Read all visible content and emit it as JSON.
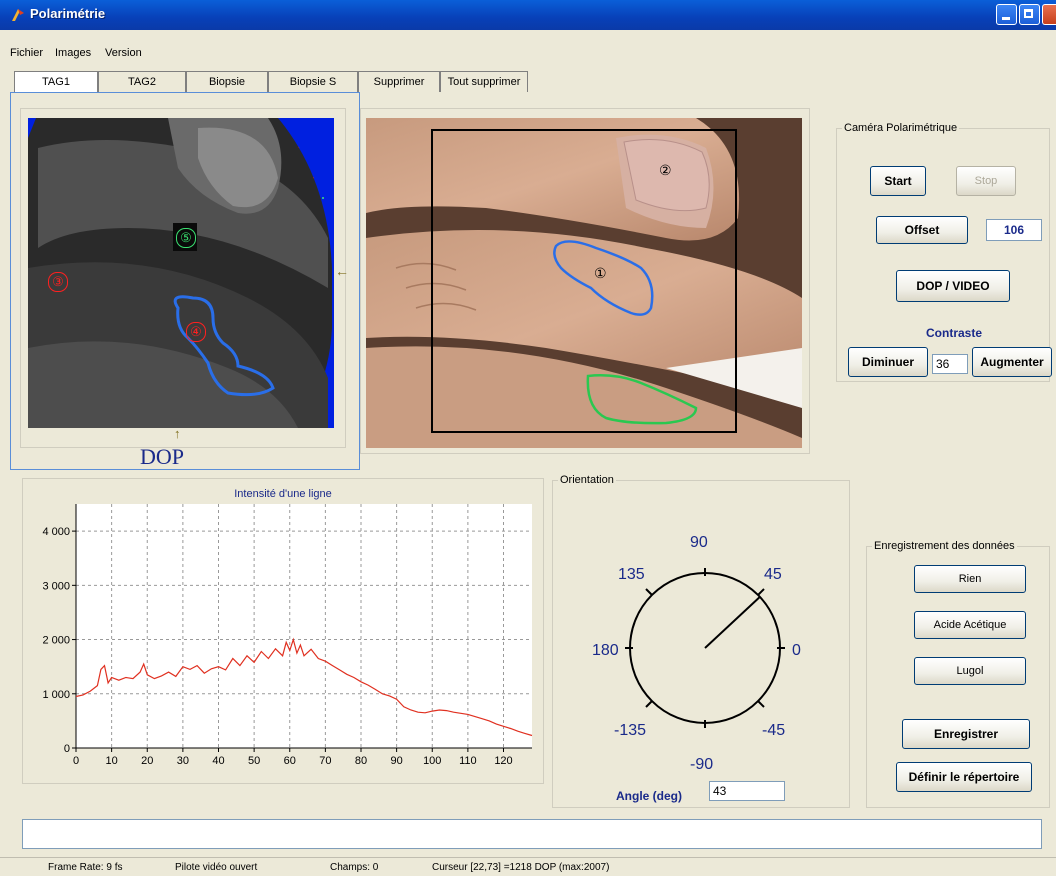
{
  "window": {
    "title": "Polarimétrie"
  },
  "menu": {
    "items": [
      "Fichier",
      "Images",
      "Version"
    ]
  },
  "tabs": [
    "TAG1",
    "TAG2",
    "Biopsie",
    "Biopsie S",
    "Supprimer",
    "Tout supprimer"
  ],
  "dop_panel": {
    "label": "DOP",
    "markers": [
      "⑤",
      "③",
      "④"
    ]
  },
  "video_panel": {
    "markers": [
      "②",
      "①"
    ]
  },
  "camera": {
    "group_title": "Caméra Polarimétrique",
    "start_label": "Start",
    "stop_label": "Stop",
    "offset_label": "Offset",
    "offset_value": "106",
    "dop_video_label": "DOP / VIDEO",
    "contraste_label": "Contraste",
    "diminuer_label": "Diminuer",
    "contraste_value": "36",
    "augmenter_label": "Augmenter"
  },
  "orientation": {
    "group_title": "Orientation",
    "labels": {
      "a90": "90",
      "a45": "45",
      "a0": "0",
      "am45": "-45",
      "am90": "-90",
      "am135": "-135",
      "a180": "180",
      "a135": "135"
    },
    "angle_label": "Angle (deg)",
    "angle_value": "43"
  },
  "recording": {
    "group_title": "Enregistrement des données",
    "rien_label": "Rien",
    "acide_label": "Acide Acétique",
    "lugol_label": "Lugol",
    "enregistrer_label": "Enregistrer",
    "definir_label": "Définir le répertoire"
  },
  "status": {
    "frame_rate": "Frame Rate: 9 fs",
    "pilote": "Pilote vidéo ouvert",
    "champs": "Champs: 0",
    "curseur": "Curseur [22,73]  =1218 DOP (max:2007)"
  },
  "chart_data": {
    "type": "line",
    "title": "Intensité d'une ligne",
    "xlabel": "",
    "ylabel": "",
    "xlim": [
      0,
      128
    ],
    "ylim": [
      0,
      4500
    ],
    "xticks": [
      0,
      10,
      20,
      30,
      40,
      50,
      60,
      70,
      80,
      90,
      100,
      110,
      120
    ],
    "yticks": [
      0,
      1000,
      2000,
      3000,
      4000
    ],
    "ytick_labels": [
      "0",
      "1 000",
      "2 000",
      "3 000",
      "4 000"
    ],
    "grid": true,
    "series": [
      {
        "color": "#e03020",
        "x": [
          0,
          2,
          4,
          6,
          7,
          8,
          9,
          10,
          12,
          14,
          16,
          18,
          19,
          20,
          22,
          24,
          26,
          28,
          30,
          32,
          34,
          36,
          38,
          40,
          42,
          44,
          46,
          48,
          50,
          52,
          54,
          56,
          58,
          59,
          60,
          61,
          62,
          63,
          64,
          66,
          68,
          70,
          72,
          74,
          76,
          78,
          80,
          82,
          84,
          86,
          88,
          90,
          92,
          94,
          96,
          98,
          100,
          102,
          104,
          106,
          108,
          110,
          112,
          114,
          116,
          118,
          120,
          122,
          124,
          126,
          128
        ],
        "y": [
          950,
          980,
          1050,
          1150,
          1450,
          1520,
          1200,
          1300,
          1250,
          1300,
          1280,
          1400,
          1550,
          1350,
          1280,
          1330,
          1400,
          1320,
          1500,
          1450,
          1520,
          1380,
          1460,
          1500,
          1440,
          1650,
          1520,
          1700,
          1580,
          1780,
          1650,
          1830,
          1700,
          1950,
          1800,
          2000,
          1750,
          1900,
          1700,
          1820,
          1650,
          1600,
          1520,
          1440,
          1360,
          1300,
          1220,
          1160,
          1080,
          1000,
          960,
          900,
          760,
          700,
          660,
          650,
          680,
          700,
          690,
          660,
          640,
          620,
          580,
          540,
          500,
          440,
          400,
          360,
          310,
          270,
          230
        ]
      }
    ]
  }
}
